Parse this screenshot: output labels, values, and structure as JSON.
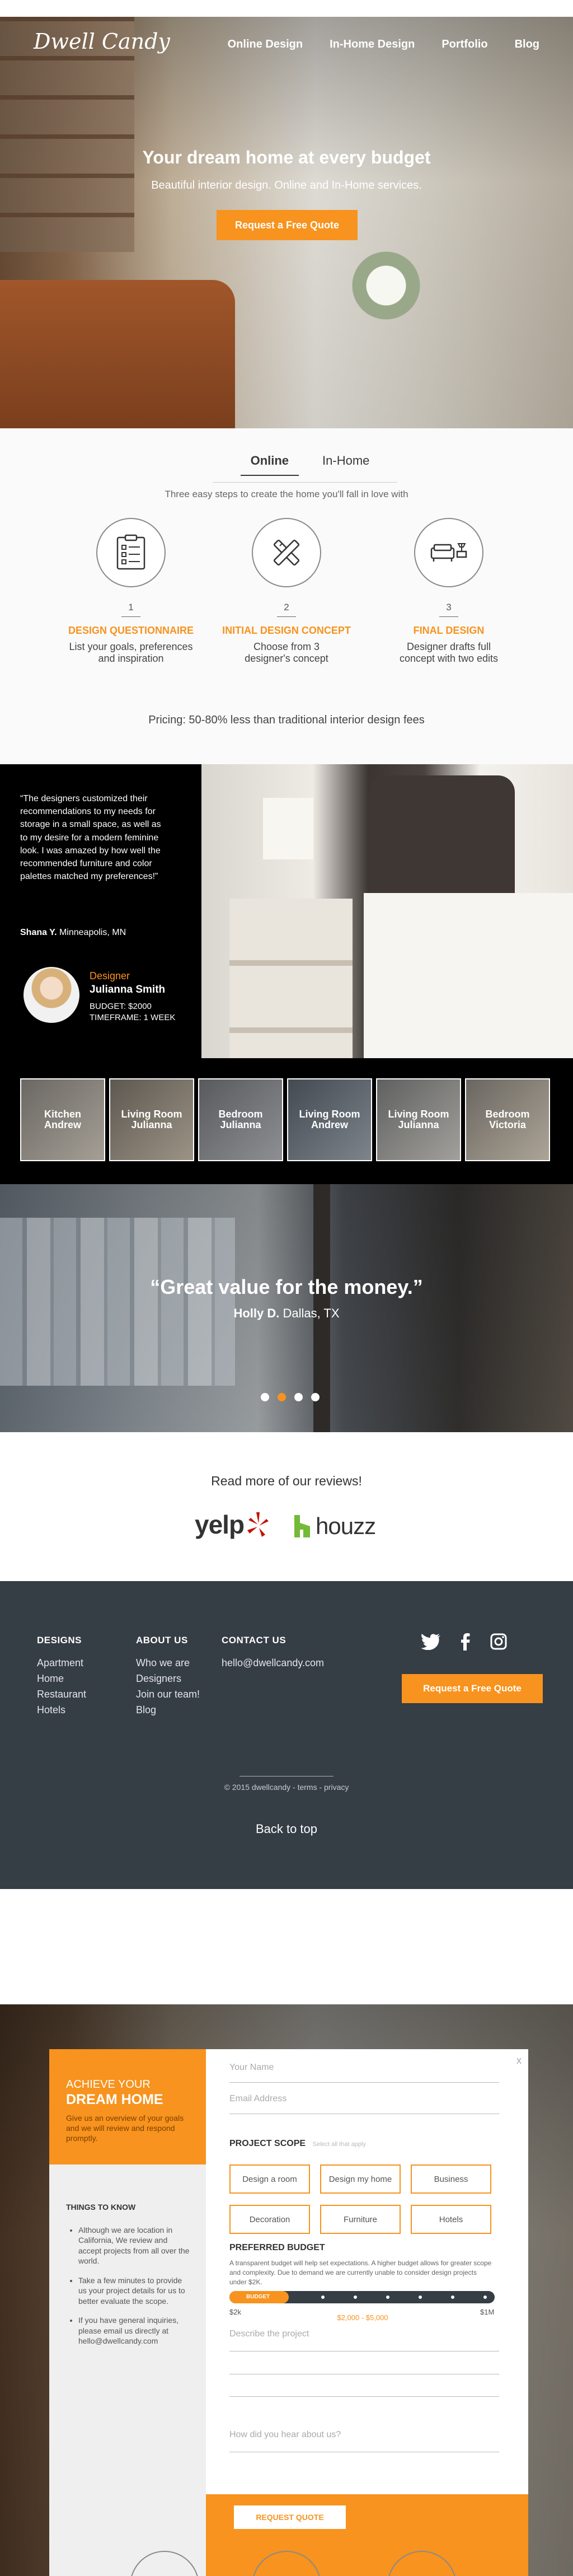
{
  "header": {
    "logo": "Dwell Candy",
    "nav": [
      "Online Design",
      "In-Home Design",
      "Portfolio",
      "Blog"
    ]
  },
  "hero": {
    "title": "Your dream home at every budget",
    "subtitle": "Beautiful interior design. Online and In-Home services.",
    "cta": "Request a Free Quote"
  },
  "how": {
    "tabs": [
      "Online",
      "In-Home"
    ],
    "intro": "Three easy steps to create the home you'll fall in love with",
    "steps": [
      {
        "num": "1",
        "title": "DESIGN QUESTIONNAIRE",
        "desc": "List your goals, preferences and inspiration",
        "icon": "clipboard-icon"
      },
      {
        "num": "2",
        "title": "INITIAL DESIGN CONCEPT",
        "desc": "Choose from 3 designer's concept",
        "icon": "tools-icon"
      },
      {
        "num": "3",
        "title": "FINAL DESIGN",
        "desc": "Designer drafts full concept with two edits",
        "icon": "sofa-icon"
      }
    ],
    "pricing": "Pricing: 50-80% less than traditional interior design fees"
  },
  "testimonial": {
    "quote": "“The designers customized their recommendations to my needs for storage in a small space, as well as to my desire for a modern feminine look. I was amazed by how well the recommended furniture and color palettes matched my preferences!”",
    "author_name": "Shana Y.",
    "author_location": "Minneapolis, MN",
    "designer_label": "Designer",
    "designer_name": "Julianna Smith",
    "budget": "BUDGET: $2000",
    "timeframe": "TIMEFRAME: 1 WEEK"
  },
  "portfolio": [
    {
      "room": "Kitchen",
      "designer": "Andrew"
    },
    {
      "room": "Living Room",
      "designer": "Julianna"
    },
    {
      "room": "Bedroom",
      "designer": "Julianna"
    },
    {
      "room": "Living Room",
      "designer": "Andrew"
    },
    {
      "room": "Living Room",
      "designer": "Julianna"
    },
    {
      "room": "Bedroom",
      "designer": "Victoria"
    }
  ],
  "quote_banner": {
    "text": "“Great value for the money.”",
    "author_name": "Holly D.",
    "author_location": "Dallas, TX",
    "active_dot": 1
  },
  "reviews": {
    "heading": "Read more of our reviews!",
    "yelp": "yelp",
    "houzz": "houzz"
  },
  "footer": {
    "col1": {
      "title": "DESIGNS",
      "links": [
        "Apartment",
        "Home",
        "Restaurant",
        "Hotels"
      ]
    },
    "col2": {
      "title": "ABOUT US",
      "links": [
        "Who we are",
        "Designers",
        "Join our team!",
        "Blog"
      ]
    },
    "col3": {
      "title": "CONTACT US",
      "links": [
        "hello@dwellcandy.com"
      ]
    },
    "cta": "Request a Free Quote",
    "copyright": "© 2015 dwellcandy - terms - privacy",
    "back_to_top": "Back to top"
  },
  "modal": {
    "close": "x",
    "heading_small": "ACHIEVE YOUR",
    "heading_big": "DREAM HOME",
    "intro": "Give us an overview of your goals and we will review and respond promptly.",
    "things_title": "THINGS TO KNOW",
    "things": [
      "Although we are location in California, We review and accept projects from all over the world.",
      "Take a few minutes to provide us your project details for us to better evaluate the scope.",
      "If you have general inquiries, please email us directly at hello@dwellcandy.com"
    ],
    "name_placeholder": "Your Name",
    "email_placeholder": "Email Address",
    "scope_title": "PROJECT SCOPE",
    "scope_hint": "Select all that apply",
    "scope_options": [
      "Design a room",
      "Design my home",
      "Business",
      "Decoration",
      "Furniture",
      "Hotels"
    ],
    "budget_title": "PREFERRED BUDGET",
    "budget_desc": "A transparent budget will help set expectations. A higher budget allows for greater scope and complexity. Due to demand we are currently unable to consider design projects under $2K.",
    "budget_label": "BUDGET",
    "budget_min": "$2k",
    "budget_max": "$1M",
    "budget_range": "$2,000 - $5,000",
    "describe_placeholder": "Describe the project",
    "hear_placeholder": "How did you hear about us?",
    "submit": "REQUEST QUOTE"
  }
}
